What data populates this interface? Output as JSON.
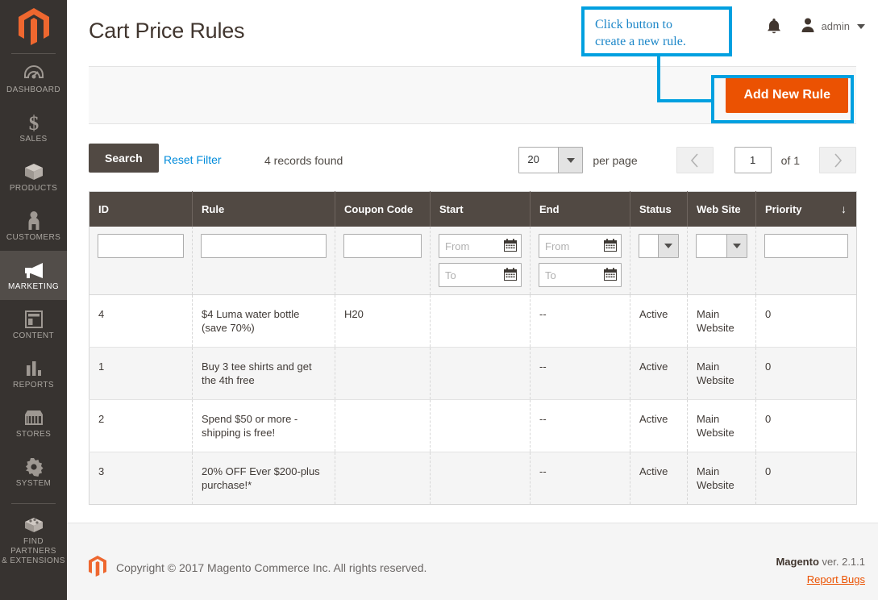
{
  "sidebar": {
    "logo_name": "magento-logo",
    "items": [
      {
        "label": "DASHBOARD",
        "icon": "dashboard-icon",
        "active": false
      },
      {
        "label": "SALES",
        "icon": "dollar-icon",
        "active": false
      },
      {
        "label": "PRODUCTS",
        "icon": "box-icon",
        "active": false
      },
      {
        "label": "CUSTOMERS",
        "icon": "person-icon",
        "active": false
      },
      {
        "label": "MARKETING",
        "icon": "megaphone-icon",
        "active": true
      },
      {
        "label": "CONTENT",
        "icon": "layout-icon",
        "active": false
      },
      {
        "label": "REPORTS",
        "icon": "bar-chart-icon",
        "active": false
      },
      {
        "label": "STORES",
        "icon": "storefront-icon",
        "active": false
      },
      {
        "label": "SYSTEM",
        "icon": "gear-icon",
        "active": false
      },
      {
        "label": "FIND PARTNERS\n& EXTENSIONS",
        "icon": "extension-icon",
        "active": false
      }
    ]
  },
  "header": {
    "title": "Cart Price Rules",
    "bell_icon": "notification-bell-icon",
    "user_icon": "user-avatar-icon",
    "user_name": "admin"
  },
  "page_actions": {
    "add_new_rule_label": "Add New Rule"
  },
  "annotation": {
    "callout_text": "Click button to\ncreate a new rule.",
    "accent_color": "#00a0e0"
  },
  "toolbar": {
    "search_label": "Search",
    "reset_filter_label": "Reset Filter",
    "records_found": "4 records found",
    "per_page_value": "20",
    "per_page_label": "per page",
    "prev_icon": "chevron-left-icon",
    "next_icon": "chevron-right-icon",
    "page_value": "1",
    "page_total": "of 1"
  },
  "grid": {
    "columns": [
      {
        "label": "ID",
        "sorted": false
      },
      {
        "label": "Rule",
        "sorted": false
      },
      {
        "label": "Coupon Code",
        "sorted": false
      },
      {
        "label": "Start",
        "sorted": false
      },
      {
        "label": "End",
        "sorted": false
      },
      {
        "label": "Status",
        "sorted": false
      },
      {
        "label": "Web Site",
        "sorted": false
      },
      {
        "label": "Priority",
        "sorted": true,
        "sort_arrow": "↓"
      }
    ],
    "filters": {
      "id": "",
      "rule": "",
      "coupon_code": "",
      "start_from_placeholder": "From",
      "start_to_placeholder": "To",
      "end_from_placeholder": "From",
      "end_to_placeholder": "To",
      "status": "",
      "web_site": "",
      "priority": "",
      "calendar_icon": "calendar-icon"
    },
    "rows": [
      {
        "id": "4",
        "rule": "$4 Luma water bottle (save 70%)",
        "coupon_code": "H20",
        "start": "",
        "end": "--",
        "status": "Active",
        "web_site": "Main Website",
        "priority": "0"
      },
      {
        "id": "1",
        "rule": "Buy 3 tee shirts and get the 4th free",
        "coupon_code": "",
        "start": "",
        "end": "--",
        "status": "Active",
        "web_site": "Main Website",
        "priority": "0"
      },
      {
        "id": "2",
        "rule": "Spend $50 or more - shipping is free!",
        "coupon_code": "",
        "start": "",
        "end": "--",
        "status": "Active",
        "web_site": "Main Website",
        "priority": "0"
      },
      {
        "id": "3",
        "rule": "20% OFF Ever $200-plus purchase!*",
        "coupon_code": "",
        "start": "",
        "end": "--",
        "status": "Active",
        "web_site": "Main Website",
        "priority": "0"
      }
    ]
  },
  "footer": {
    "logo_name": "magento-logo-small",
    "copyright": "Copyright © 2017 Magento Commerce Inc. All rights reserved.",
    "version_brand": "Magento",
    "version_text": " ver. 2.1.1",
    "report_bugs_label": "Report Bugs"
  }
}
